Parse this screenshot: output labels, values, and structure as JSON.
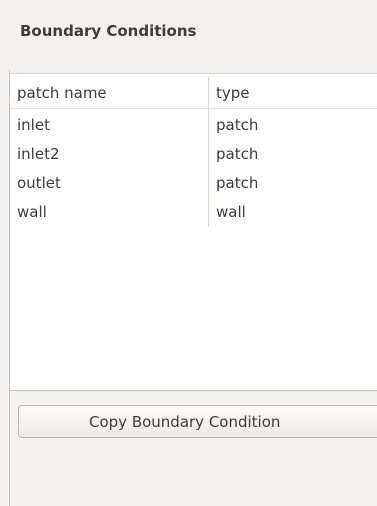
{
  "panel": {
    "title": "Boundary Conditions"
  },
  "table": {
    "columns": [
      "patch name",
      "type"
    ],
    "rows": [
      {
        "name": "inlet",
        "type": "patch"
      },
      {
        "name": "inlet2",
        "type": "patch"
      },
      {
        "name": "outlet",
        "type": "patch"
      },
      {
        "name": "wall",
        "type": "wall"
      }
    ]
  },
  "actions": {
    "copy_label": "Copy Boundary Condition"
  }
}
